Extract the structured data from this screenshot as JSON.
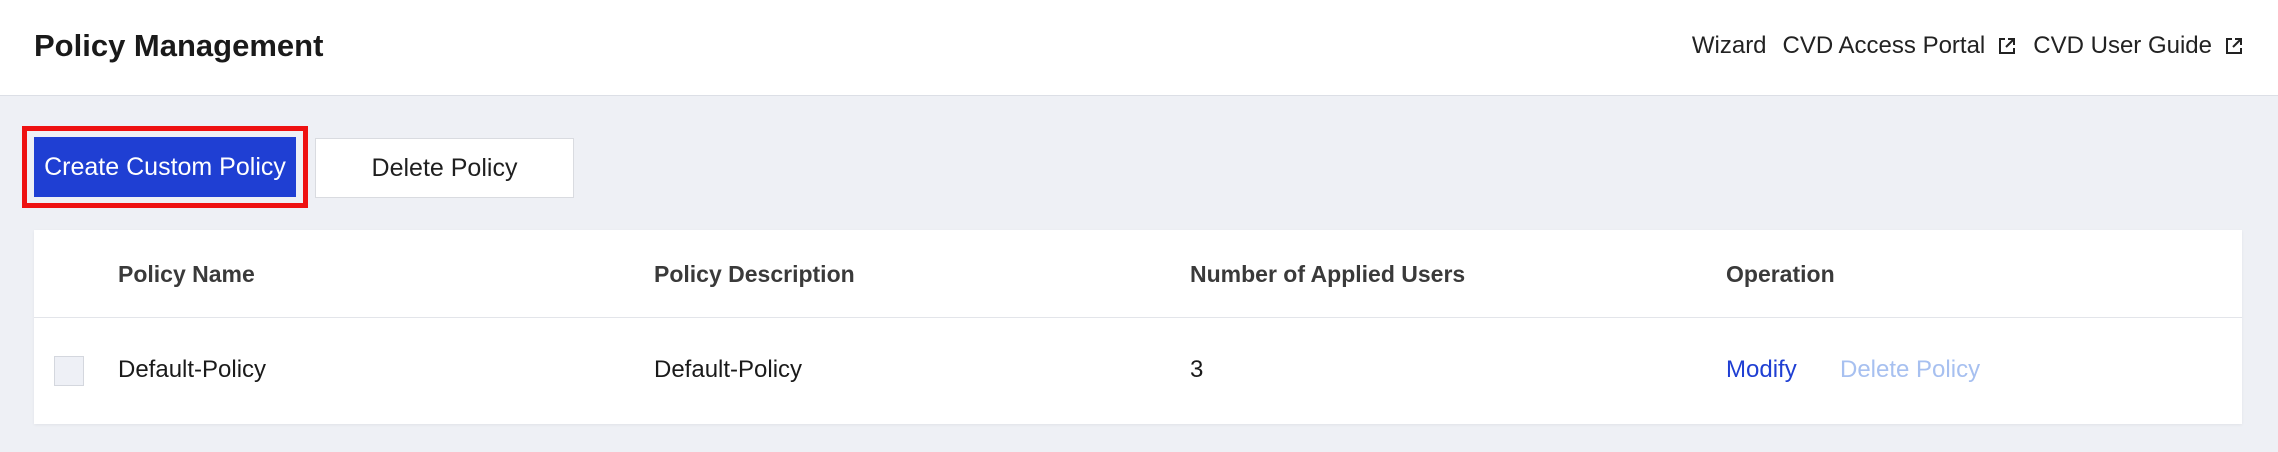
{
  "header": {
    "title": "Policy Management",
    "links": {
      "wizard": "Wizard",
      "access_portal": "CVD Access Portal",
      "user_guide": "CVD User Guide"
    },
    "external_icon": "external-link-icon"
  },
  "toolbar": {
    "create_label": "Create Custom Policy",
    "delete_label": "Delete Policy"
  },
  "table": {
    "columns": {
      "name": "Policy Name",
      "description": "Policy Description",
      "users": "Number of Applied Users",
      "operation": "Operation"
    },
    "rows": [
      {
        "name": "Default-Policy",
        "description": "Default-Policy",
        "users": "3",
        "modify": "Modify",
        "delete": "Delete Policy"
      }
    ]
  },
  "colors": {
    "primary": "#1f3fd3",
    "highlight_border": "#ee1111",
    "disabled_link": "#a7c0f0",
    "background": "#eef0f5"
  }
}
